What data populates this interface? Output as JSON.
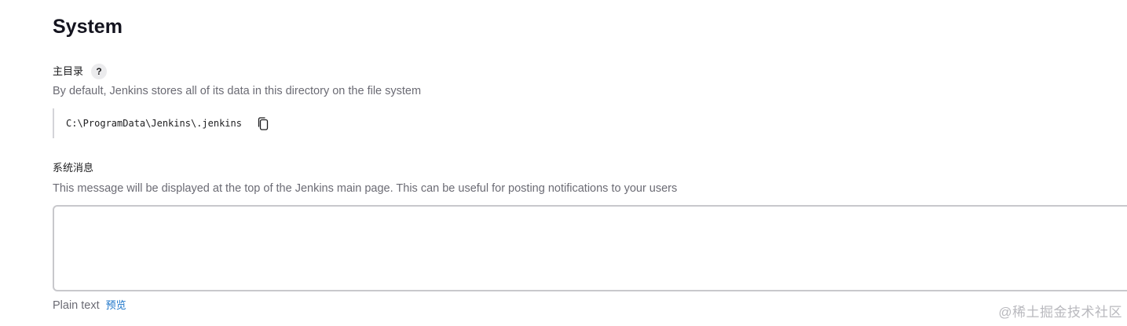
{
  "page": {
    "title": "System"
  },
  "home_directory": {
    "label": "主目录",
    "help_label": "?",
    "description": "By default, Jenkins stores all of its data in this directory on the file system",
    "path": "C:\\ProgramData\\Jenkins\\.jenkins",
    "copy_icon": "copy-icon"
  },
  "system_message": {
    "label": "系统消息",
    "description": "This message will be displayed at the top of the Jenkins main page. This can be useful for posting notifications to your users",
    "value": "",
    "format_label": "Plain text",
    "preview_label": "预览"
  },
  "watermark": {
    "text": "@稀土掘金技术社区"
  },
  "colors": {
    "link": "#1a73c8",
    "muted_text": "#6b6b74",
    "border": "#c8c8cc"
  }
}
